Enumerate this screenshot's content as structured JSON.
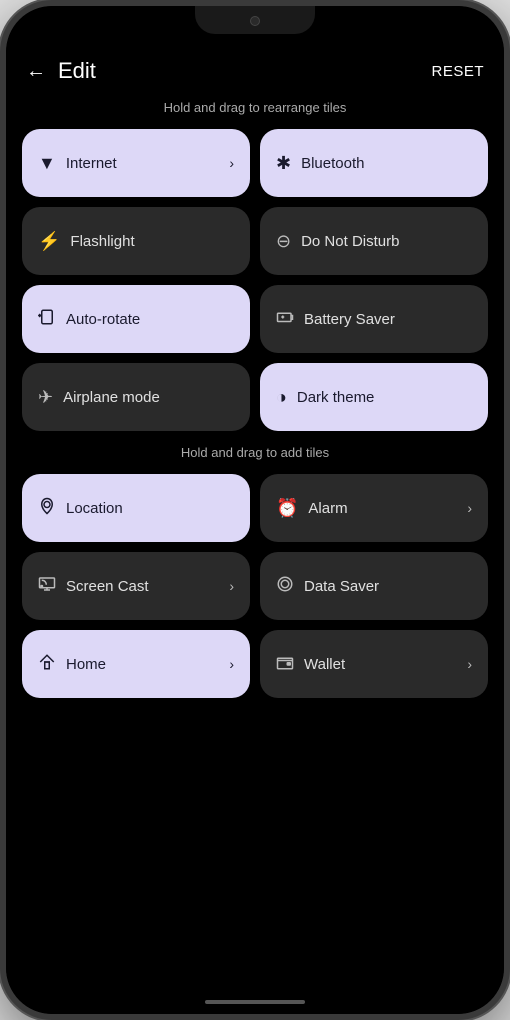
{
  "header": {
    "back_label": "←",
    "title": "Edit",
    "reset_label": "RESET"
  },
  "active_hint": "Hold and drag to rearrange tiles",
  "add_hint": "Hold and drag to add tiles",
  "active_tiles": [
    {
      "id": "internet",
      "label": "Internet",
      "icon": "wifi",
      "style": "light",
      "chevron": true
    },
    {
      "id": "bluetooth",
      "label": "Bluetooth",
      "icon": "bluetooth",
      "style": "light",
      "chevron": false
    },
    {
      "id": "flashlight",
      "label": "Flashlight",
      "icon": "flashlight",
      "style": "dark",
      "chevron": false
    },
    {
      "id": "do-not-disturb",
      "label": "Do Not Disturb",
      "icon": "dnd",
      "style": "dark",
      "chevron": false
    },
    {
      "id": "auto-rotate",
      "label": "Auto-rotate",
      "icon": "autorotate",
      "style": "light",
      "chevron": false
    },
    {
      "id": "battery-saver",
      "label": "Battery Saver",
      "icon": "battery",
      "style": "dark",
      "chevron": false
    },
    {
      "id": "airplane-mode",
      "label": "Airplane mode",
      "icon": "airplane",
      "style": "dark",
      "chevron": false
    },
    {
      "id": "dark-theme",
      "label": "Dark theme",
      "icon": "darktheme",
      "style": "light",
      "chevron": false
    }
  ],
  "add_tiles": [
    {
      "id": "location",
      "label": "Location",
      "icon": "location",
      "style": "light",
      "chevron": false
    },
    {
      "id": "alarm",
      "label": "Alarm",
      "icon": "alarm",
      "style": "dark",
      "chevron": true
    },
    {
      "id": "screen-cast",
      "label": "Screen Cast",
      "icon": "screencast",
      "style": "dark",
      "chevron": true
    },
    {
      "id": "data-saver",
      "label": "Data Saver",
      "icon": "datasaver",
      "style": "dark",
      "chevron": false
    },
    {
      "id": "home",
      "label": "Home",
      "icon": "home",
      "style": "light",
      "chevron": true
    },
    {
      "id": "wallet",
      "label": "Wallet",
      "icon": "wallet",
      "style": "dark",
      "chevron": true
    }
  ],
  "icons": {
    "wifi": "▼",
    "bluetooth": "✱",
    "flashlight": "⚡",
    "dnd": "⊖",
    "autorotate": "⟳",
    "battery": "🔋",
    "airplane": "✈",
    "darktheme": "◑",
    "location": "◎",
    "alarm": "⏰",
    "screencast": "▭",
    "datasaver": "◯",
    "home": "⌂",
    "wallet": "▬"
  }
}
